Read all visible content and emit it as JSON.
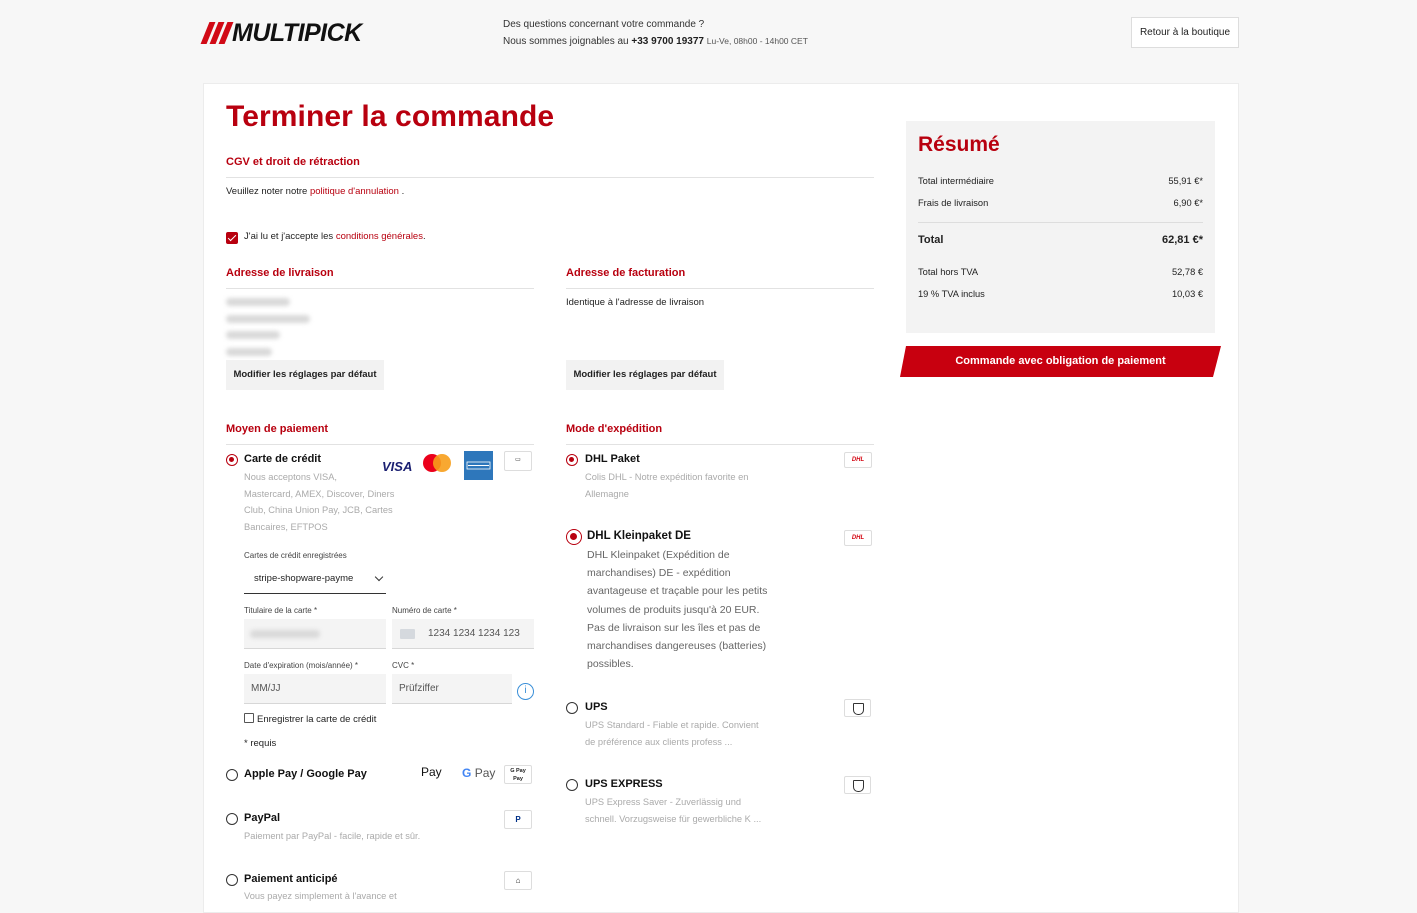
{
  "brand": {
    "name": "MULTIPICK",
    "accent": "#b8000f"
  },
  "header": {
    "help_title": "Des questions concernant votre commande ?",
    "help_prefix": "Nous sommes joignables au",
    "phone": "+33 9700 19377",
    "hours": "Lu-Ve, 08h00 - 14h00 CET",
    "back_label": "Retour à la boutique"
  },
  "page_title": "Terminer la commande",
  "cgv": {
    "title": "CGV et droit de rétraction",
    "note_prefix": "Veuillez noter notre",
    "note_link": "politique d'annulation",
    "note_suffix": ".",
    "accept_prefix": "J'ai lu et j'accepte les",
    "accept_link": "conditions générales",
    "accept_suffix": "."
  },
  "shipping_address": {
    "title": "Adresse de livraison",
    "button": "Modifier les réglages par défaut"
  },
  "billing_address": {
    "title": "Adresse de facturation",
    "text": "Identique à l'adresse de livraison",
    "button": "Modifier les réglages par défaut"
  },
  "payment": {
    "title": "Moyen de paiement",
    "credit_card": {
      "label": "Carte de crédit",
      "desc": [
        "Nous acceptons VISA,",
        "Mastercard, AMEX, Discover, Diners",
        "Club, China Union Pay, JCB, Cartes",
        "Bancaires, EFTPOS"
      ],
      "saved_label": "Cartes de crédit enregistrées",
      "saved_value": "stripe-shopware-payme",
      "holder_label": "Titulaire de la carte *",
      "number_label": "Numéro de carte *",
      "number_placeholder": "1234 1234 1234 123",
      "expiry_label": "Date d'expiration (mois/année) *",
      "expiry_placeholder": "MM/JJ",
      "cvc_label": "CVC *",
      "cvc_placeholder": "Prüfziffer",
      "save_card": "Enregistrer la carte de crédit",
      "required": "* requis",
      "icons": [
        "visa-icon",
        "mastercard-icon",
        "amex-icon",
        "card-icon"
      ]
    },
    "apple_google": {
      "label": "Apple Pay / Google Pay",
      "apple": "Pay",
      "google": "Pay"
    },
    "paypal": {
      "label": "PayPal",
      "desc": "Paiement par PayPal - facile, rapide et sûr."
    },
    "prepay": {
      "label": "Paiement anticipé",
      "desc": "Vous payez simplement à l'avance et"
    }
  },
  "shipping": {
    "title": "Mode d'expédition",
    "options": [
      {
        "label": "DHL Paket",
        "desc": [
          "Colis DHL - Notre expédition favorite en",
          "Allemagne"
        ]
      },
      {
        "label": "DHL Kleinpaket DE",
        "desc": [
          "DHL Kleinpaket (Expédition de",
          "marchandises) DE - expédition",
          "avantageuse et traçable pour les petits",
          "volumes de produits jusqu'à 20 EUR.",
          "Pas de livraison sur les îles et pas de",
          "marchandises dangereuses (batteries)",
          "possibles."
        ]
      },
      {
        "label": "UPS",
        "desc": [
          "UPS Standard - Fiable et rapide. Convient",
          "de préférence aux clients profess ..."
        ]
      },
      {
        "label": "UPS EXPRESS",
        "desc": [
          "UPS Express Saver - Zuverlässig und",
          "schnell. Vorzugsweise für gewerbliche K ..."
        ]
      }
    ],
    "dhl_logo": "DHL"
  },
  "summary": {
    "title": "Résumé",
    "subtotal_label": "Total intermédiaire",
    "subtotal": "55,91 €*",
    "shipping_label": "Frais de livraison",
    "shipping": "6,90 €*",
    "total_label": "Total",
    "total": "62,81 €*",
    "net_label": "Total hors TVA",
    "net": "52,78 €",
    "vat_label": "19 % TVA inclus",
    "vat": "10,03 €",
    "order_button": "Commande avec obligation de paiement"
  }
}
